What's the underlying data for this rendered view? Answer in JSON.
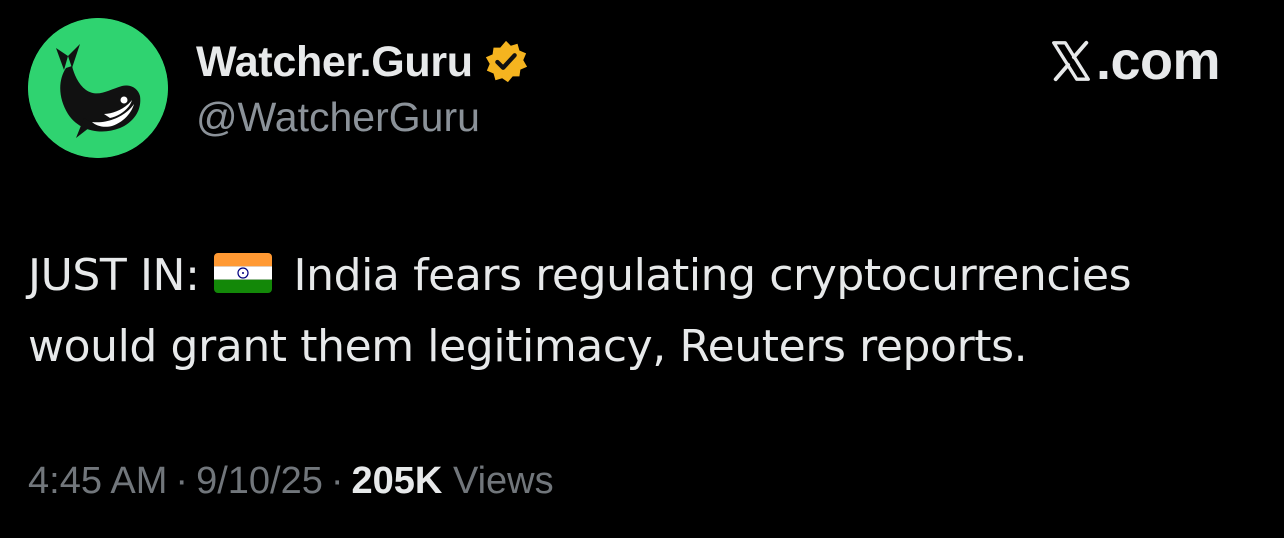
{
  "account": {
    "display_name": "Watcher.Guru",
    "handle": "@WatcherGuru",
    "avatar_icon": "whale-logo",
    "verified_icon": "verified-badge-icon",
    "avatar_color": "#2fd370",
    "badge_color": "#f5b41f"
  },
  "platform": {
    "label": ".com",
    "logo_icon": "x-logo-icon"
  },
  "tweet": {
    "prefix": "JUST IN:",
    "flag_icon": "india-flag",
    "line1": "India fears regulating cryptocurrencies",
    "line2": "would grant them legitimacy, Reuters reports."
  },
  "meta": {
    "time": "4:45 AM",
    "date": "9/10/25",
    "separator": "·",
    "views_count": "205K",
    "views_label": "Views"
  }
}
